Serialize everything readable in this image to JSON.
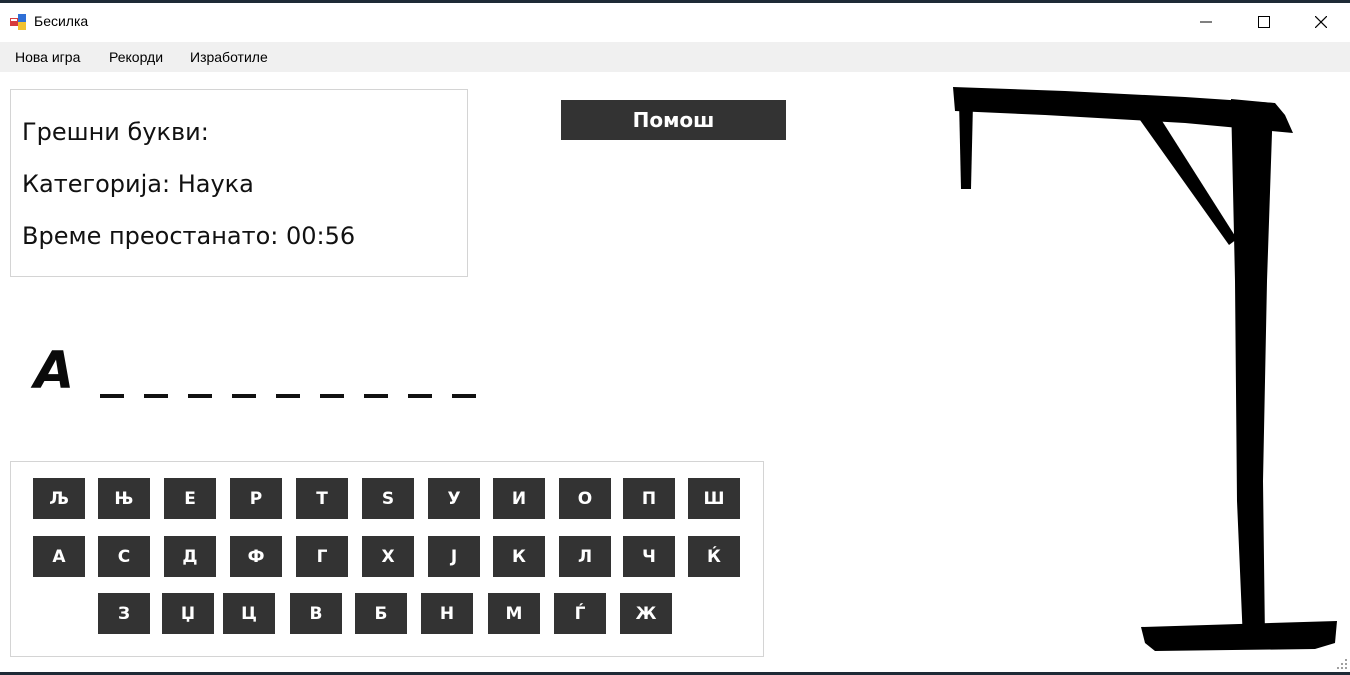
{
  "window": {
    "title": "Бесилка",
    "icon": "winforms-app-icon",
    "controls": [
      "minimize-icon",
      "maximize-icon",
      "close-icon"
    ]
  },
  "menu": {
    "items": [
      {
        "label": "Нова игра"
      },
      {
        "label": "Рекорди"
      },
      {
        "label": "Изработиле"
      }
    ]
  },
  "info": {
    "wrong_letters_label": "Грешни букви:",
    "category_line": "Категорија: Наука",
    "time_line": "Време преостанато: 00:56"
  },
  "help_button": {
    "label": "Помош"
  },
  "word": {
    "revealed": "А",
    "blank_count": 9
  },
  "keyboard": {
    "rows": [
      [
        "Љ",
        "Њ",
        "Е",
        "Р",
        "Т",
        "S",
        "У",
        "И",
        "О",
        "П",
        "Ш"
      ],
      [
        "А",
        "С",
        "Д",
        "Ф",
        "Г",
        "Х",
        "Ј",
        "К",
        "Л",
        "Ч",
        "Ќ"
      ],
      [
        "З",
        "Џ",
        "Ц",
        "В",
        "Б",
        "Н",
        "М",
        "Ѓ",
        "Ж"
      ]
    ]
  },
  "colors": {
    "key_bg": "#333333",
    "key_text": "#ffffff",
    "window_bg": "#ffffff",
    "menubar_bg": "#f0f0f0"
  }
}
